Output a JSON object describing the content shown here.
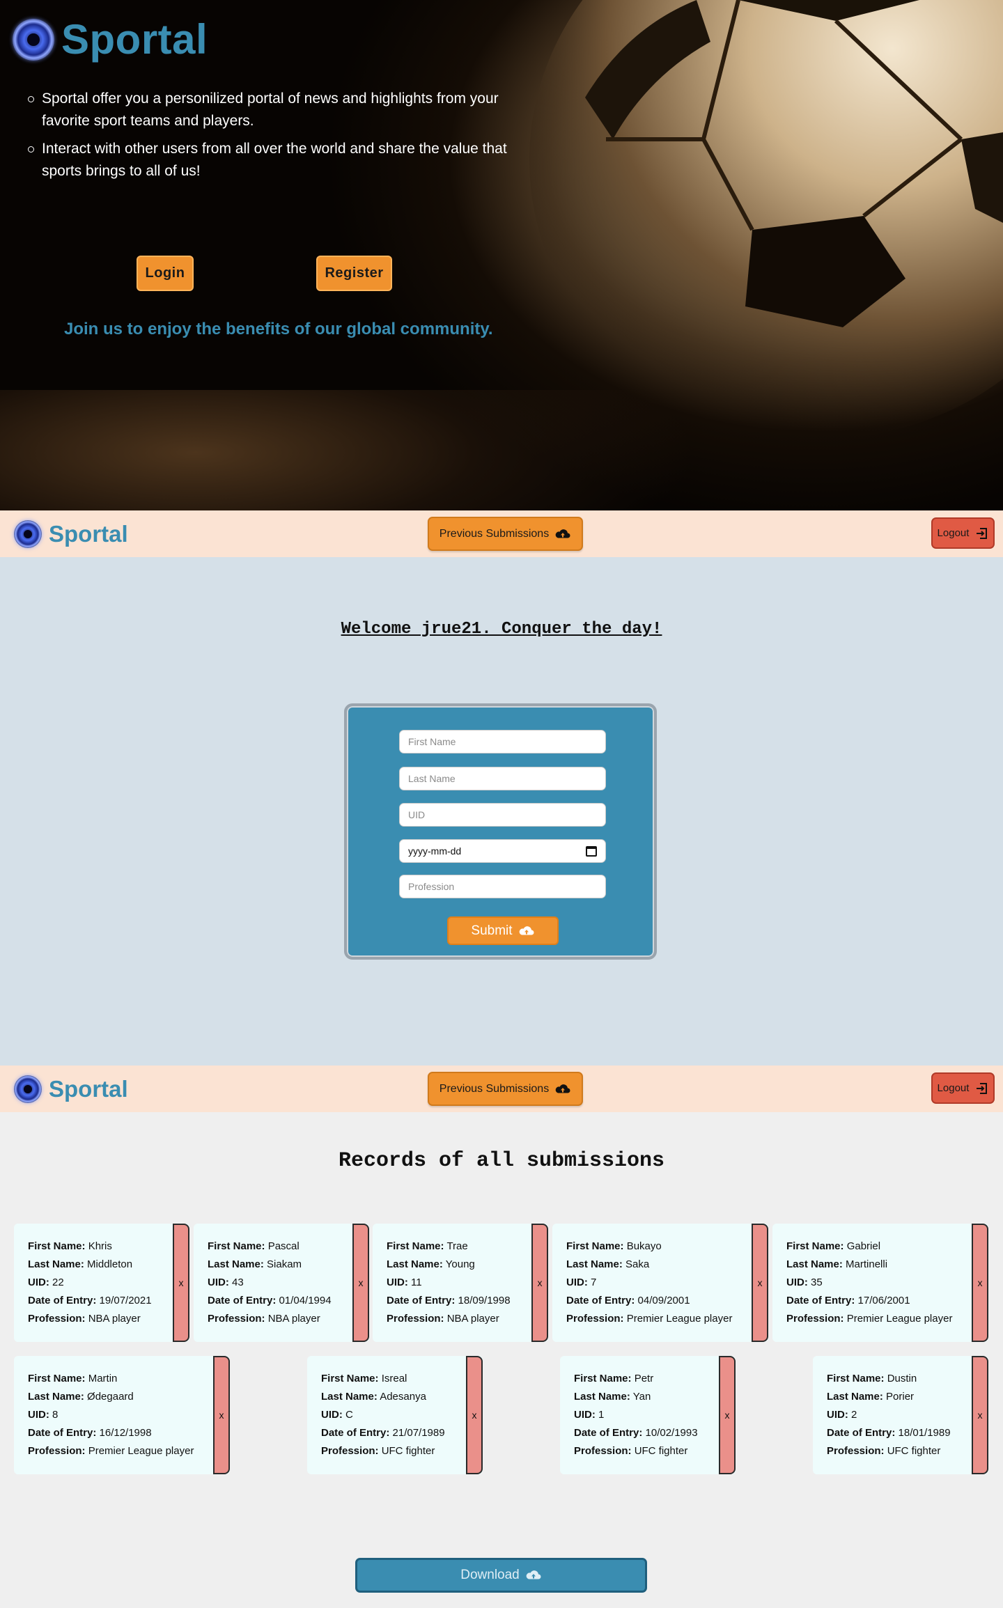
{
  "hero": {
    "title": "Sportal",
    "bullets": [
      "Sportal offer you a personilized portal of news and highlights from your favorite sport teams and players.",
      "Interact with other users from all over the world and share the value that sports brings to all of us!"
    ],
    "login_label": "Login",
    "register_label": "Register",
    "join_text": "Join us to enjoy the benefits of our global community."
  },
  "navbar": {
    "title": "Sportal",
    "prev_label": "Previous Submissions",
    "logout_label": "Logout"
  },
  "form": {
    "welcome": "Welcome jrue21. Conquer the day!",
    "first_name_placeholder": "First Name",
    "last_name_placeholder": "Last Name",
    "uid_placeholder": "UID",
    "date_placeholder": "yyyy-mm-dd",
    "profession_placeholder": "Profession",
    "submit_label": "Submit"
  },
  "records": {
    "title": "Records of all submissions",
    "labels": {
      "first": "First Name:",
      "last": "Last Name:",
      "uid": "UID:",
      "date": "Date of Entry:",
      "profession": "Profession:"
    },
    "delete_label": "x",
    "items": [
      {
        "first": "Khris",
        "last": "Middleton",
        "uid": "22",
        "date": "19/07/2021",
        "profession": "NBA player"
      },
      {
        "first": "Pascal",
        "last": "Siakam",
        "uid": "43",
        "date": "01/04/1994",
        "profession": "NBA player"
      },
      {
        "first": "Trae",
        "last": "Young",
        "uid": "11",
        "date": "18/09/1998",
        "profession": "NBA player"
      },
      {
        "first": "Bukayo",
        "last": "Saka",
        "uid": "7",
        "date": "04/09/2001",
        "profession": "Premier League player"
      },
      {
        "first": "Gabriel",
        "last": "Martinelli",
        "uid": "35",
        "date": "17/06/2001",
        "profession": "Premier League player"
      },
      {
        "first": "Martin",
        "last": "Ødegaard",
        "uid": "8",
        "date": "16/12/1998",
        "profession": "Premier League player"
      },
      {
        "first": "Isreal",
        "last": "Adesanya",
        "uid": "C",
        "date": "21/07/1989",
        "profession": "UFC fighter"
      },
      {
        "first": "Petr",
        "last": "Yan",
        "uid": "1",
        "date": "10/02/1993",
        "profession": "UFC fighter"
      },
      {
        "first": "Dustin",
        "last": "Porier",
        "uid": "2",
        "date": "18/01/1989",
        "profession": "UFC fighter"
      }
    ],
    "download_label": "Download"
  },
  "colors": {
    "brand_blue": "#3a8db1",
    "orange": "#f0922e",
    "logout_red": "#e05a44",
    "nav_bg": "#fbe3d3",
    "form_bg": "#d5e0e8",
    "card_bg": "#eefcfc",
    "delete_bg": "#ea908a"
  },
  "icons": [
    "globe-logo-icon",
    "cloud-upload-icon",
    "logout-icon",
    "calendar-icon"
  ]
}
